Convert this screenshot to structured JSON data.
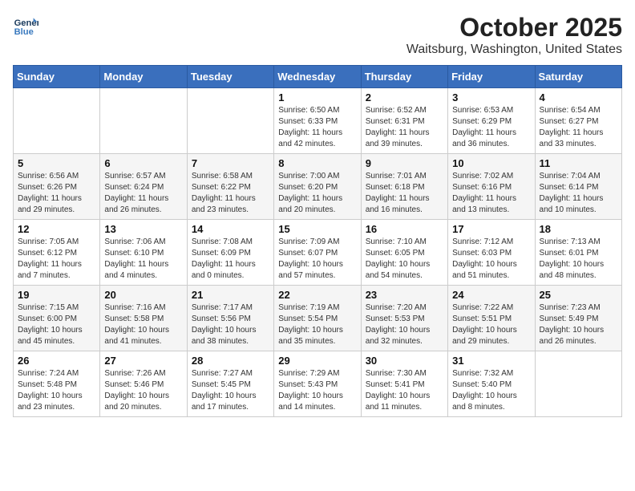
{
  "header": {
    "logo_line1": "General",
    "logo_line2": "Blue",
    "month": "October 2025",
    "location": "Waitsburg, Washington, United States"
  },
  "weekdays": [
    "Sunday",
    "Monday",
    "Tuesday",
    "Wednesday",
    "Thursday",
    "Friday",
    "Saturday"
  ],
  "weeks": [
    [
      {
        "day": "",
        "info": ""
      },
      {
        "day": "",
        "info": ""
      },
      {
        "day": "",
        "info": ""
      },
      {
        "day": "1",
        "info": "Sunrise: 6:50 AM\nSunset: 6:33 PM\nDaylight: 11 hours\nand 42 minutes."
      },
      {
        "day": "2",
        "info": "Sunrise: 6:52 AM\nSunset: 6:31 PM\nDaylight: 11 hours\nand 39 minutes."
      },
      {
        "day": "3",
        "info": "Sunrise: 6:53 AM\nSunset: 6:29 PM\nDaylight: 11 hours\nand 36 minutes."
      },
      {
        "day": "4",
        "info": "Sunrise: 6:54 AM\nSunset: 6:27 PM\nDaylight: 11 hours\nand 33 minutes."
      }
    ],
    [
      {
        "day": "5",
        "info": "Sunrise: 6:56 AM\nSunset: 6:26 PM\nDaylight: 11 hours\nand 29 minutes."
      },
      {
        "day": "6",
        "info": "Sunrise: 6:57 AM\nSunset: 6:24 PM\nDaylight: 11 hours\nand 26 minutes."
      },
      {
        "day": "7",
        "info": "Sunrise: 6:58 AM\nSunset: 6:22 PM\nDaylight: 11 hours\nand 23 minutes."
      },
      {
        "day": "8",
        "info": "Sunrise: 7:00 AM\nSunset: 6:20 PM\nDaylight: 11 hours\nand 20 minutes."
      },
      {
        "day": "9",
        "info": "Sunrise: 7:01 AM\nSunset: 6:18 PM\nDaylight: 11 hours\nand 16 minutes."
      },
      {
        "day": "10",
        "info": "Sunrise: 7:02 AM\nSunset: 6:16 PM\nDaylight: 11 hours\nand 13 minutes."
      },
      {
        "day": "11",
        "info": "Sunrise: 7:04 AM\nSunset: 6:14 PM\nDaylight: 11 hours\nand 10 minutes."
      }
    ],
    [
      {
        "day": "12",
        "info": "Sunrise: 7:05 AM\nSunset: 6:12 PM\nDaylight: 11 hours\nand 7 minutes."
      },
      {
        "day": "13",
        "info": "Sunrise: 7:06 AM\nSunset: 6:10 PM\nDaylight: 11 hours\nand 4 minutes."
      },
      {
        "day": "14",
        "info": "Sunrise: 7:08 AM\nSunset: 6:09 PM\nDaylight: 11 hours\nand 0 minutes."
      },
      {
        "day": "15",
        "info": "Sunrise: 7:09 AM\nSunset: 6:07 PM\nDaylight: 10 hours\nand 57 minutes."
      },
      {
        "day": "16",
        "info": "Sunrise: 7:10 AM\nSunset: 6:05 PM\nDaylight: 10 hours\nand 54 minutes."
      },
      {
        "day": "17",
        "info": "Sunrise: 7:12 AM\nSunset: 6:03 PM\nDaylight: 10 hours\nand 51 minutes."
      },
      {
        "day": "18",
        "info": "Sunrise: 7:13 AM\nSunset: 6:01 PM\nDaylight: 10 hours\nand 48 minutes."
      }
    ],
    [
      {
        "day": "19",
        "info": "Sunrise: 7:15 AM\nSunset: 6:00 PM\nDaylight: 10 hours\nand 45 minutes."
      },
      {
        "day": "20",
        "info": "Sunrise: 7:16 AM\nSunset: 5:58 PM\nDaylight: 10 hours\nand 41 minutes."
      },
      {
        "day": "21",
        "info": "Sunrise: 7:17 AM\nSunset: 5:56 PM\nDaylight: 10 hours\nand 38 minutes."
      },
      {
        "day": "22",
        "info": "Sunrise: 7:19 AM\nSunset: 5:54 PM\nDaylight: 10 hours\nand 35 minutes."
      },
      {
        "day": "23",
        "info": "Sunrise: 7:20 AM\nSunset: 5:53 PM\nDaylight: 10 hours\nand 32 minutes."
      },
      {
        "day": "24",
        "info": "Sunrise: 7:22 AM\nSunset: 5:51 PM\nDaylight: 10 hours\nand 29 minutes."
      },
      {
        "day": "25",
        "info": "Sunrise: 7:23 AM\nSunset: 5:49 PM\nDaylight: 10 hours\nand 26 minutes."
      }
    ],
    [
      {
        "day": "26",
        "info": "Sunrise: 7:24 AM\nSunset: 5:48 PM\nDaylight: 10 hours\nand 23 minutes."
      },
      {
        "day": "27",
        "info": "Sunrise: 7:26 AM\nSunset: 5:46 PM\nDaylight: 10 hours\nand 20 minutes."
      },
      {
        "day": "28",
        "info": "Sunrise: 7:27 AM\nSunset: 5:45 PM\nDaylight: 10 hours\nand 17 minutes."
      },
      {
        "day": "29",
        "info": "Sunrise: 7:29 AM\nSunset: 5:43 PM\nDaylight: 10 hours\nand 14 minutes."
      },
      {
        "day": "30",
        "info": "Sunrise: 7:30 AM\nSunset: 5:41 PM\nDaylight: 10 hours\nand 11 minutes."
      },
      {
        "day": "31",
        "info": "Sunrise: 7:32 AM\nSunset: 5:40 PM\nDaylight: 10 hours\nand 8 minutes."
      },
      {
        "day": "",
        "info": ""
      }
    ]
  ]
}
